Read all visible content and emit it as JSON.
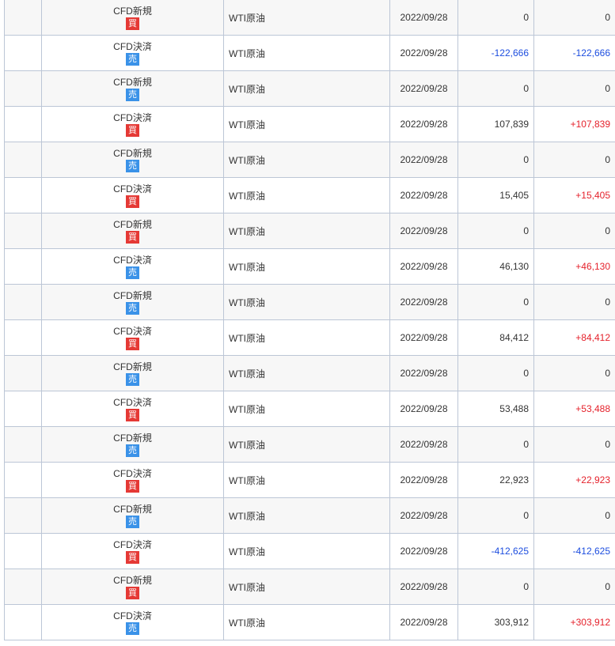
{
  "colors": {
    "row_alt": "#f7f7f7",
    "border": "#bcc6d6",
    "buy_badge": "#e53935",
    "sell_badge": "#3a92e8",
    "negative_text": "#1c4ddf",
    "positive_text": "#e5212b"
  },
  "rows": [
    {
      "trade_type": "CFD新規",
      "side": "買",
      "side_kind": "buy",
      "name": "WTI原油",
      "date": "2022/09/28",
      "amount": "0",
      "pl": "0",
      "pl_sign": "zero"
    },
    {
      "trade_type": "CFD決済",
      "side": "売",
      "side_kind": "sell",
      "name": "WTI原油",
      "date": "2022/09/28",
      "amount": "-122,666",
      "pl": "-122,666",
      "pl_sign": "neg"
    },
    {
      "trade_type": "CFD新規",
      "side": "売",
      "side_kind": "sell",
      "name": "WTI原油",
      "date": "2022/09/28",
      "amount": "0",
      "pl": "0",
      "pl_sign": "zero"
    },
    {
      "trade_type": "CFD決済",
      "side": "買",
      "side_kind": "buy",
      "name": "WTI原油",
      "date": "2022/09/28",
      "amount": "107,839",
      "pl": "+107,839",
      "pl_sign": "pos"
    },
    {
      "trade_type": "CFD新規",
      "side": "売",
      "side_kind": "sell",
      "name": "WTI原油",
      "date": "2022/09/28",
      "amount": "0",
      "pl": "0",
      "pl_sign": "zero"
    },
    {
      "trade_type": "CFD決済",
      "side": "買",
      "side_kind": "buy",
      "name": "WTI原油",
      "date": "2022/09/28",
      "amount": "15,405",
      "pl": "+15,405",
      "pl_sign": "pos"
    },
    {
      "trade_type": "CFD新規",
      "side": "買",
      "side_kind": "buy",
      "name": "WTI原油",
      "date": "2022/09/28",
      "amount": "0",
      "pl": "0",
      "pl_sign": "zero"
    },
    {
      "trade_type": "CFD決済",
      "side": "売",
      "side_kind": "sell",
      "name": "WTI原油",
      "date": "2022/09/28",
      "amount": "46,130",
      "pl": "+46,130",
      "pl_sign": "pos"
    },
    {
      "trade_type": "CFD新規",
      "side": "売",
      "side_kind": "sell",
      "name": "WTI原油",
      "date": "2022/09/28",
      "amount": "0",
      "pl": "0",
      "pl_sign": "zero"
    },
    {
      "trade_type": "CFD決済",
      "side": "買",
      "side_kind": "buy",
      "name": "WTI原油",
      "date": "2022/09/28",
      "amount": "84,412",
      "pl": "+84,412",
      "pl_sign": "pos"
    },
    {
      "trade_type": "CFD新規",
      "side": "売",
      "side_kind": "sell",
      "name": "WTI原油",
      "date": "2022/09/28",
      "amount": "0",
      "pl": "0",
      "pl_sign": "zero"
    },
    {
      "trade_type": "CFD決済",
      "side": "買",
      "side_kind": "buy",
      "name": "WTI原油",
      "date": "2022/09/28",
      "amount": "53,488",
      "pl": "+53,488",
      "pl_sign": "pos"
    },
    {
      "trade_type": "CFD新規",
      "side": "売",
      "side_kind": "sell",
      "name": "WTI原油",
      "date": "2022/09/28",
      "amount": "0",
      "pl": "0",
      "pl_sign": "zero"
    },
    {
      "trade_type": "CFD決済",
      "side": "買",
      "side_kind": "buy",
      "name": "WTI原油",
      "date": "2022/09/28",
      "amount": "22,923",
      "pl": "+22,923",
      "pl_sign": "pos"
    },
    {
      "trade_type": "CFD新規",
      "side": "売",
      "side_kind": "sell",
      "name": "WTI原油",
      "date": "2022/09/28",
      "amount": "0",
      "pl": "0",
      "pl_sign": "zero"
    },
    {
      "trade_type": "CFD決済",
      "side": "買",
      "side_kind": "buy",
      "name": "WTI原油",
      "date": "2022/09/28",
      "amount": "-412,625",
      "pl": "-412,625",
      "pl_sign": "neg"
    },
    {
      "trade_type": "CFD新規",
      "side": "買",
      "side_kind": "buy",
      "name": "WTI原油",
      "date": "2022/09/28",
      "amount": "0",
      "pl": "0",
      "pl_sign": "zero"
    },
    {
      "trade_type": "CFD決済",
      "side": "売",
      "side_kind": "sell",
      "name": "WTI原油",
      "date": "2022/09/28",
      "amount": "303,912",
      "pl": "+303,912",
      "pl_sign": "pos"
    }
  ]
}
